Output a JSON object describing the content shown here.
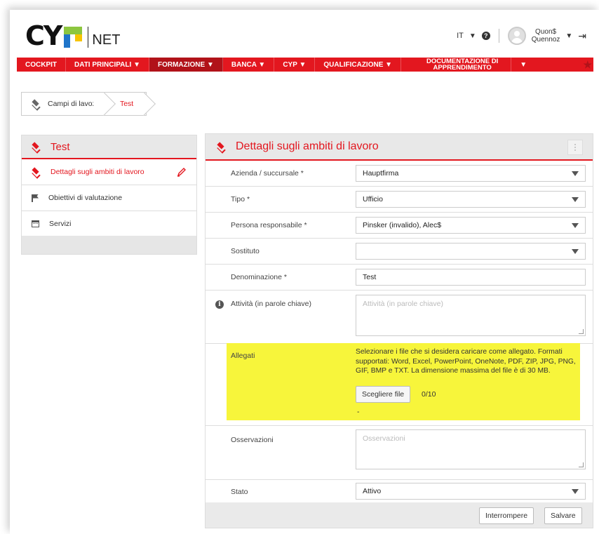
{
  "header": {
    "logo_text": "NET",
    "language": "IT",
    "user": {
      "line1": "Quon$",
      "line2": "Quennoz"
    }
  },
  "nav": {
    "items": [
      {
        "label": "COCKPIT"
      },
      {
        "label": "DATI PRINCIPALI ▼"
      },
      {
        "label": "FORMAZIONE ▼"
      },
      {
        "label": "BANCA ▼"
      },
      {
        "label": "CYP ▼"
      },
      {
        "label": "QUALIFICAZIONE ▼"
      }
    ],
    "doc_line1": "DOCUMENTAZIONE DI",
    "doc_line2": "APPRENDIMENTO",
    "doc_caret": "▼"
  },
  "breadcrumb": {
    "items": [
      "Campi di lavoro",
      "Test"
    ]
  },
  "sidebar": {
    "title": "Test",
    "items": [
      {
        "label": "Dettagli sugli ambiti di lavoro",
        "icon": "layers-icon"
      },
      {
        "label": "Obiettivi di valutazione",
        "icon": "flag-icon"
      },
      {
        "label": "Servizi",
        "icon": "calendar-icon"
      }
    ]
  },
  "form": {
    "title": "Dettagli sugli ambiti di lavoro",
    "fields": {
      "azienda": {
        "label": "Azienda / succursale *",
        "value": "Hauptfirma"
      },
      "tipo": {
        "label": "Tipo *",
        "value": "Ufficio"
      },
      "persona": {
        "label": "Persona responsabile *",
        "value": "Pinsker (invalido), Alec$"
      },
      "sostituto": {
        "label": "Sostituto",
        "value": ""
      },
      "denominazione": {
        "label": "Denominazione *",
        "value": "Test"
      },
      "attivita": {
        "label": "Attività (in parole chiave)",
        "placeholder": "Attività (in parole chiave)"
      },
      "allegati": {
        "label": "Allegati",
        "note": "Selezionare i file che si desidera caricare come allegato. Formati supportati: Word, Excel, PowerPoint, OneNote, PDF, ZIP, JPG, PNG, GIF, BMP e TXT. La dimensione massima del file è di 30 MB.",
        "button": "Scegliere file",
        "count": "0/10",
        "dash": "-"
      },
      "osservazioni": {
        "label": "Osservazioni",
        "placeholder": "Osservazioni"
      },
      "stato": {
        "label": "Stato",
        "value": "Attivo"
      }
    },
    "buttons": {
      "cancel": "Interrompere",
      "save": "Salvare"
    }
  },
  "colors": {
    "accent": "#e3171f",
    "highlight": "#f7f53b"
  }
}
